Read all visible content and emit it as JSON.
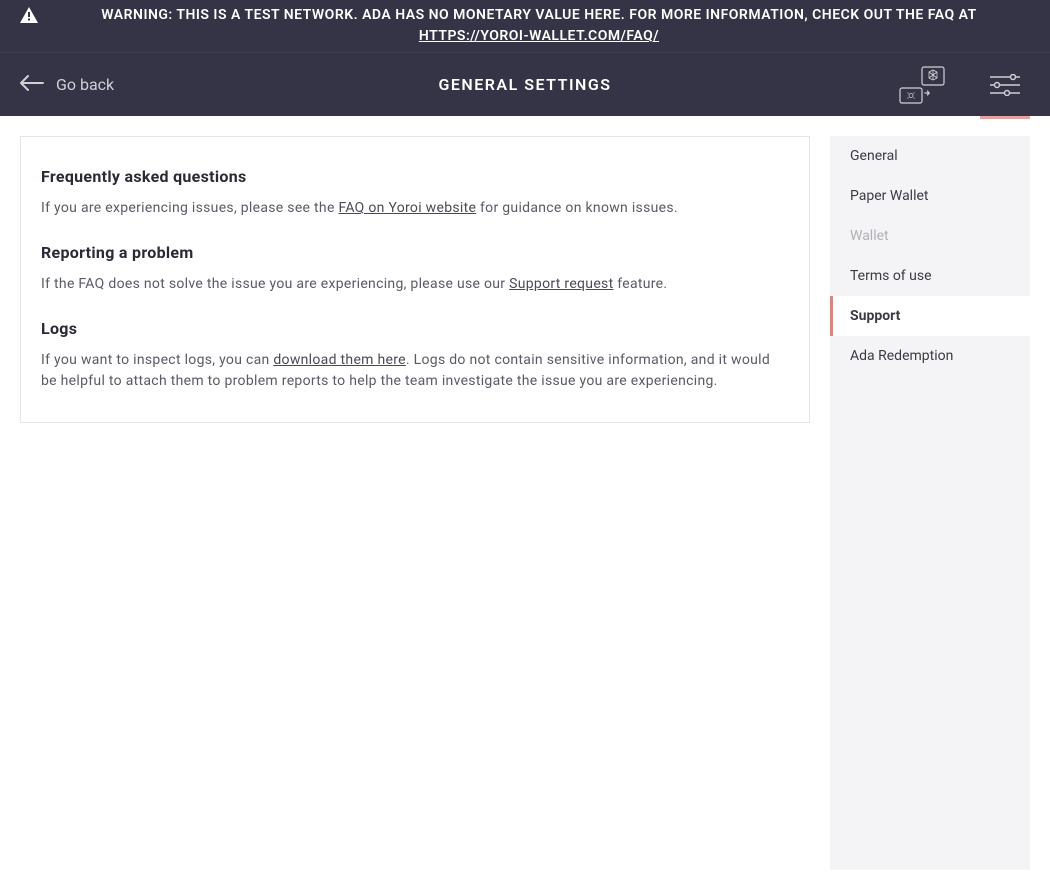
{
  "banner": {
    "text_before_link": "WARNING: THIS IS A TEST NETWORK. ADA HAS NO MONETARY VALUE HERE. FOR MORE INFORMATION, CHECK OUT THE FAQ AT ",
    "link_text": "HTTPS://YOROI-WALLET.COM/FAQ/"
  },
  "topbar": {
    "go_back_label": "Go back",
    "title": "GENERAL SETTINGS"
  },
  "main": {
    "faq": {
      "heading": "Frequently asked questions",
      "text_before": "If you are experiencing issues, please see the ",
      "link": "FAQ on Yoroi website",
      "text_after": " for guidance on known issues."
    },
    "reporting": {
      "heading": "Reporting a problem",
      "text_before": "If the FAQ does not solve the issue you are experiencing, please use our ",
      "link": "Support request",
      "text_after": " feature."
    },
    "logs": {
      "heading": "Logs",
      "text_before": "If you want to inspect logs, you can ",
      "link": "download them here",
      "text_after": ". Logs do not contain sensitive information, and it would be helpful to attach them to problem reports to help the team investigate the issue you are experiencing."
    }
  },
  "sidebar": {
    "items": [
      {
        "label": "General",
        "active": false,
        "disabled": false
      },
      {
        "label": "Paper Wallet",
        "active": false,
        "disabled": false
      },
      {
        "label": "Wallet",
        "active": false,
        "disabled": true
      },
      {
        "label": "Terms of use",
        "active": false,
        "disabled": false
      },
      {
        "label": "Support",
        "active": true,
        "disabled": false
      },
      {
        "label": "Ada Redemption",
        "active": false,
        "disabled": false
      }
    ]
  }
}
